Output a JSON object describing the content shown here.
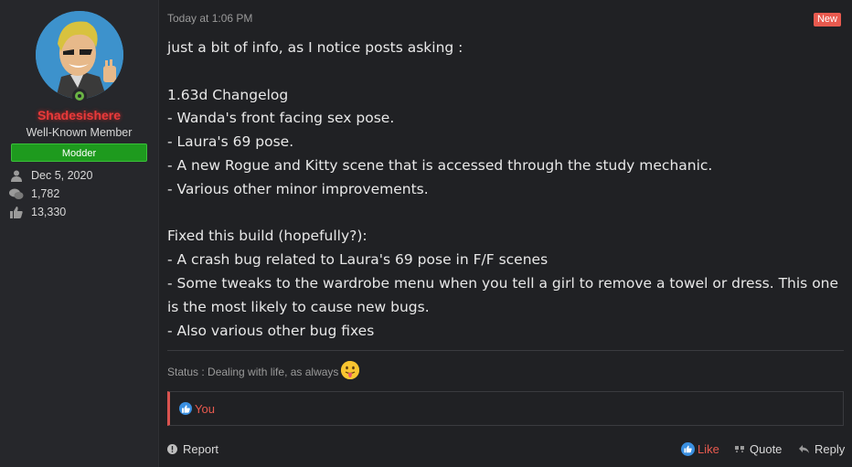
{
  "user": {
    "username": "Shadesishere",
    "title": "Well-Known Member",
    "banner": "Modder",
    "stats": {
      "joined": "Dec 5, 2020",
      "messages": "1,782",
      "reactions": "13,330"
    },
    "online": true
  },
  "post": {
    "date": "Today at 1:06 PM",
    "badge": "New",
    "body": "just a bit of info, as I notice posts asking :\n\n1.63d Changelog\n- Wanda's front facing sex pose.\n- Laura's 69 pose.\n- A new Rogue and Kitty scene that is accessed through the study mechanic.\n- Various other minor improvements.\n\nFixed this build (hopefully?):\n- A crash bug related to Laura's 69 pose in F/F scenes\n- Some tweaks to the wardrobe menu when you tell a girl to remove a towel or dress. This one is the most likely to cause new bugs.\n- Also various other bug fixes",
    "status": "Status : Dealing with life, as always",
    "status_emoji": "tongue-out-emoji",
    "reactions_label": "You"
  },
  "actions": {
    "report": "Report",
    "like": "Like",
    "quote": "Quote",
    "reply": "Reply"
  },
  "colors": {
    "username": "#e83a3a",
    "banner": "#1e9a1e",
    "new_badge": "#e85a4f",
    "like": "#e85a4f",
    "reaction_bar": "#d9534f"
  }
}
